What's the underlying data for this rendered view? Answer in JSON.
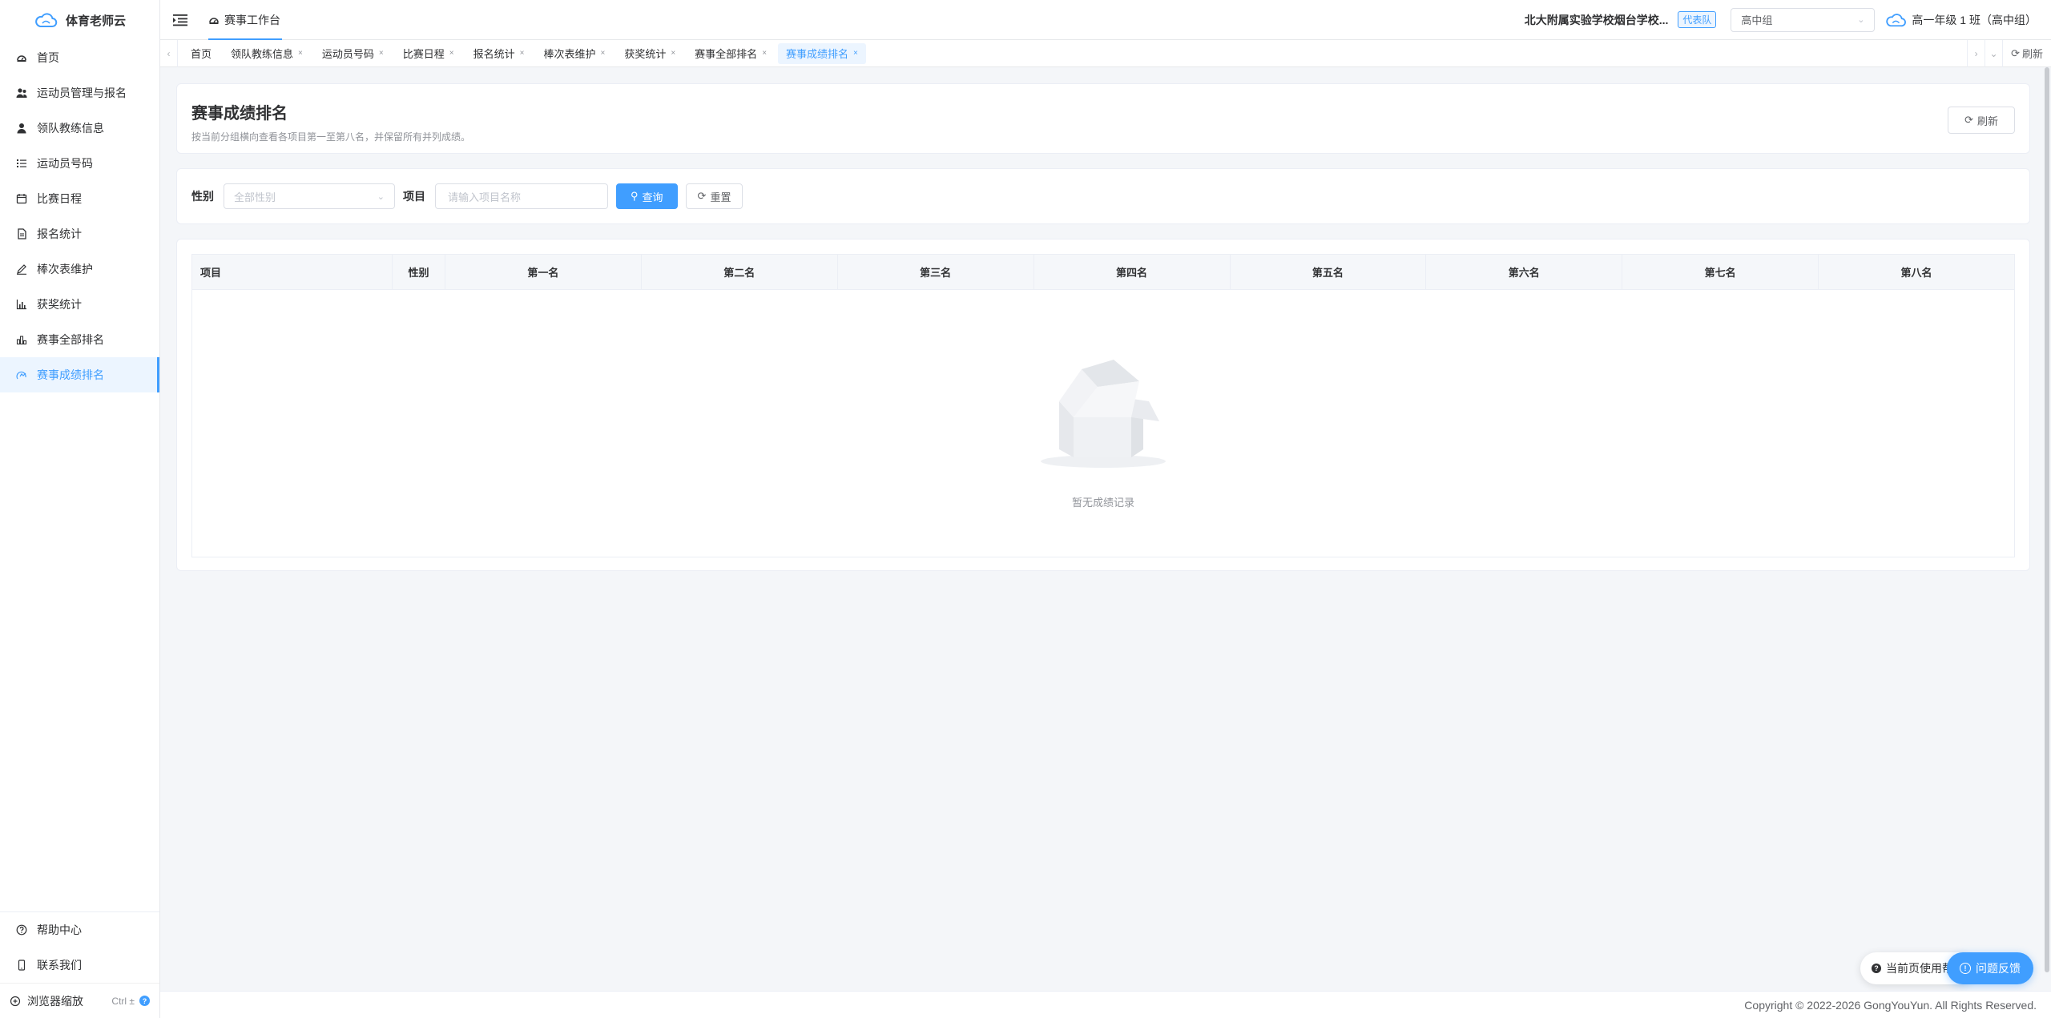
{
  "app": {
    "name": "体育老师云"
  },
  "sidebar": {
    "items": [
      {
        "label": "首页",
        "icon": "dashboard-icon"
      },
      {
        "label": "运动员管理与报名",
        "icon": "users-icon"
      },
      {
        "label": "领队教练信息",
        "icon": "user-icon"
      },
      {
        "label": "运动员号码",
        "icon": "list-icon"
      },
      {
        "label": "比赛日程",
        "icon": "calendar-icon"
      },
      {
        "label": "报名统计",
        "icon": "document-icon"
      },
      {
        "label": "棒次表维护",
        "icon": "edit-icon"
      },
      {
        "label": "获奖统计",
        "icon": "chart-icon"
      },
      {
        "label": "赛事全部排名",
        "icon": "bar-chart-icon"
      },
      {
        "label": "赛事成绩排名",
        "icon": "ranking-icon"
      }
    ],
    "bottom": {
      "help": "帮助中心",
      "contact": "联系我们",
      "zoom": "浏览器缩放",
      "zoom_shortcut": "Ctrl ±",
      "zoom_hint": "?"
    }
  },
  "header": {
    "workspace_tab": "赛事工作台",
    "school": "北大附属实验学校烟台学校...",
    "team_tag": "代表队",
    "group": "高中组",
    "class_label": "高一年级 1 班（高中组）"
  },
  "tabs": {
    "items": [
      {
        "label": "首页",
        "closable": false
      },
      {
        "label": "领队教练信息",
        "closable": true
      },
      {
        "label": "运动员号码",
        "closable": true
      },
      {
        "label": "比赛日程",
        "closable": true
      },
      {
        "label": "报名统计",
        "closable": true
      },
      {
        "label": "棒次表维护",
        "closable": true
      },
      {
        "label": "获奖统计",
        "closable": true
      },
      {
        "label": "赛事全部排名",
        "closable": true
      },
      {
        "label": "赛事成绩排名",
        "closable": true,
        "active": true
      }
    ],
    "close_glyph": "×",
    "refresh": "刷新"
  },
  "page": {
    "title": "赛事成绩排名",
    "description": "按当前分组横向查看各项目第一至第八名，并保留所有并列成绩。",
    "refresh_button": "刷新"
  },
  "filters": {
    "gender_label": "性别",
    "gender_placeholder": "全部性别",
    "event_label": "项目",
    "event_placeholder": "请输入项目名称",
    "search_button": "查询",
    "reset_button": "重置"
  },
  "table": {
    "columns": [
      "项目",
      "性别",
      "第一名",
      "第二名",
      "第三名",
      "第四名",
      "第五名",
      "第六名",
      "第七名",
      "第八名"
    ],
    "empty_text": "暂无成绩记录"
  },
  "footer": {
    "copyright": "Copyright © 2022-2026 GongYouYun. All Rights Reserved."
  },
  "float": {
    "help": "当前页使用帮助",
    "feedback": "问题反馈"
  },
  "colors": {
    "accent": "#409eff",
    "background": "#f4f6f9"
  }
}
